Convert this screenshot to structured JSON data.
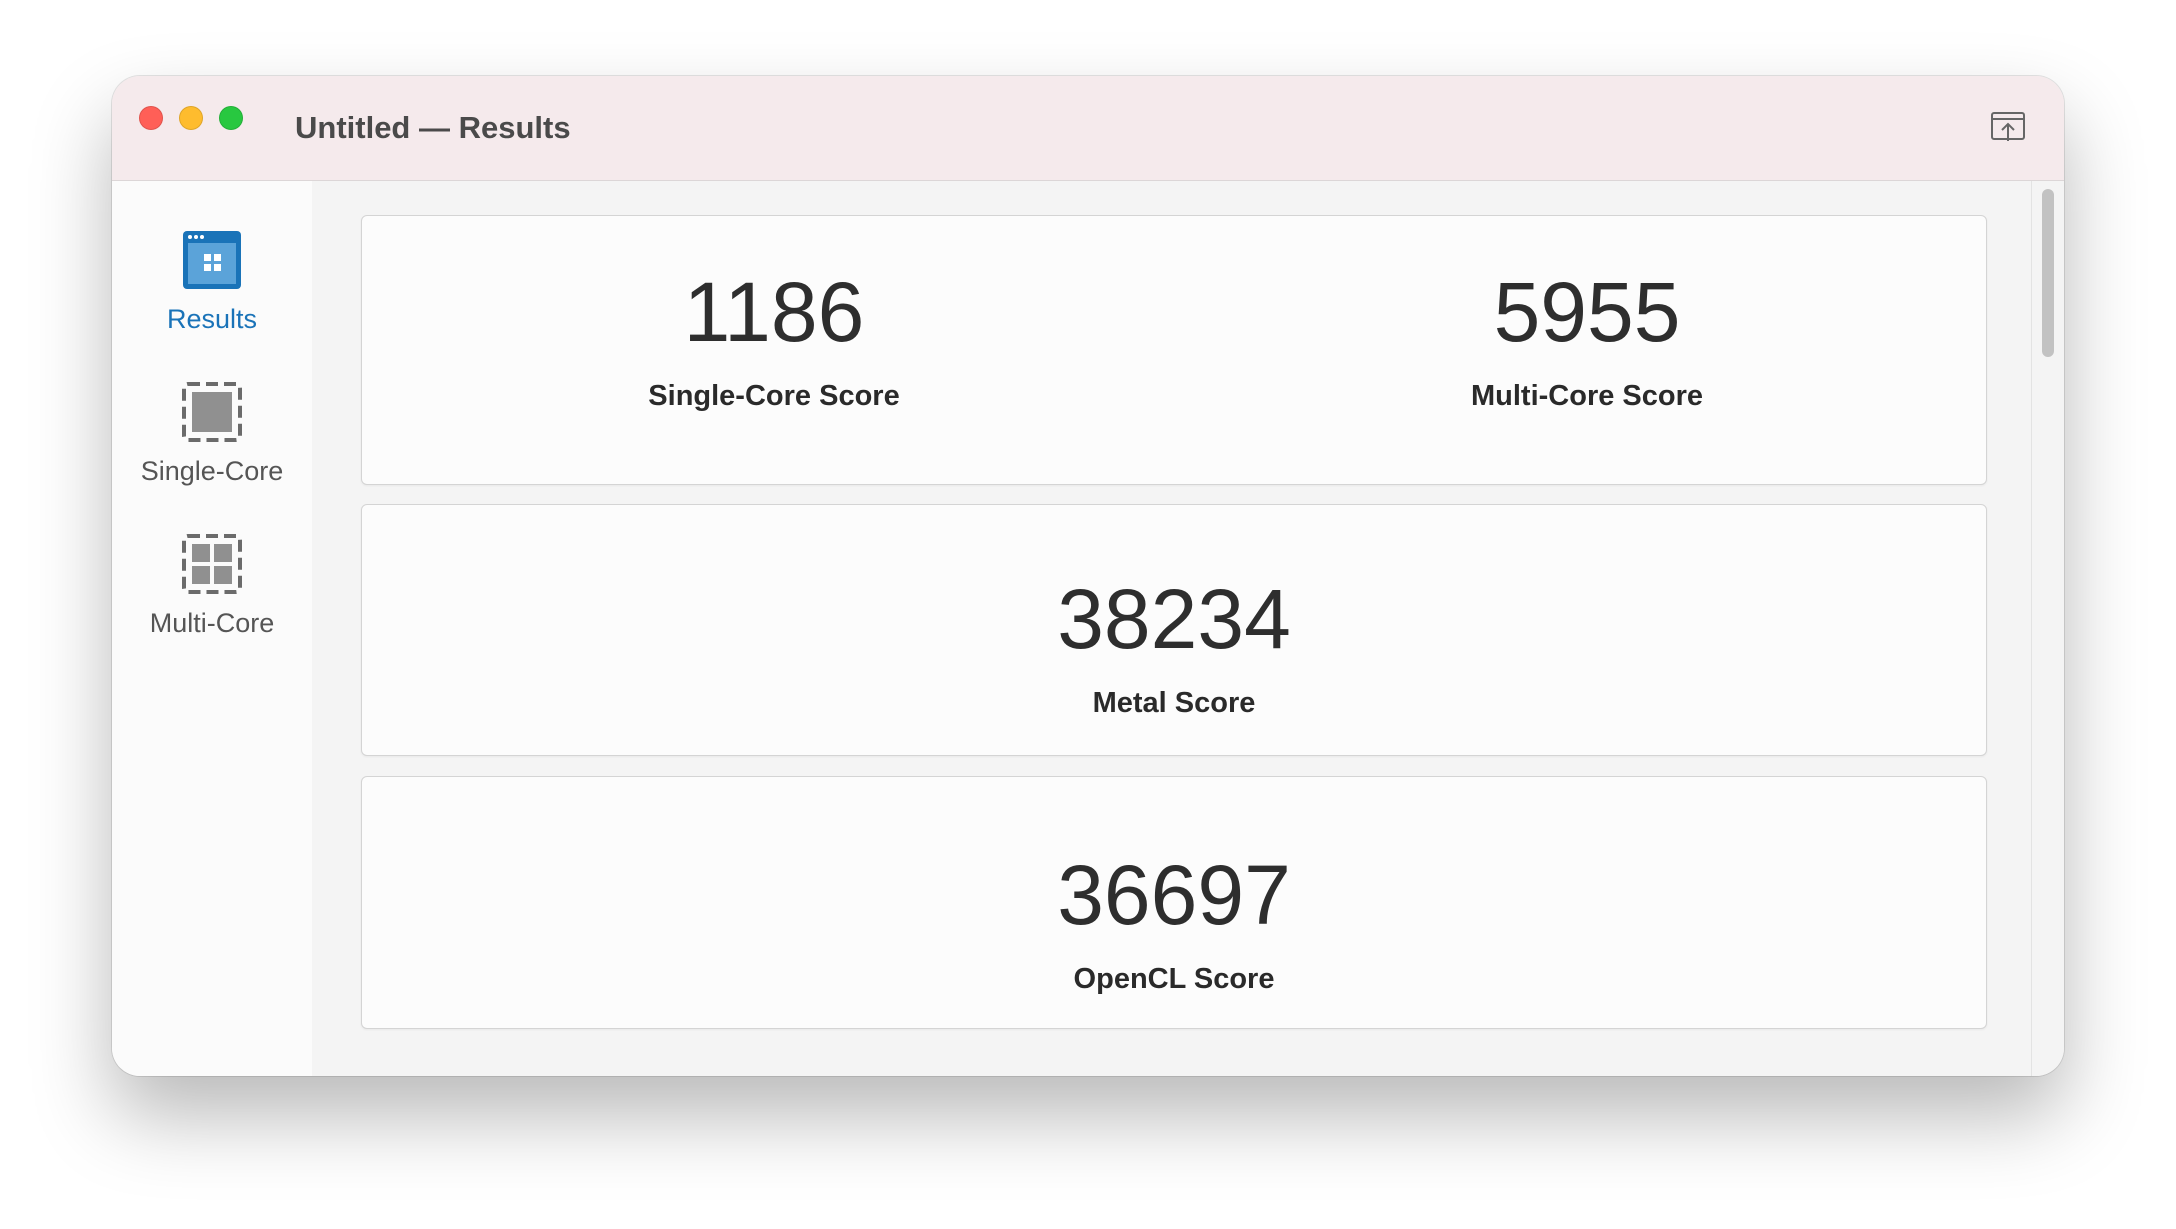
{
  "window": {
    "title": "Untitled — Results"
  },
  "toolbar": {
    "share_icon": "share-icon"
  },
  "sidebar": {
    "items": [
      {
        "label": "Results",
        "icon": "results-icon",
        "active": true
      },
      {
        "label": "Single-Core",
        "icon": "single-core-icon",
        "active": false
      },
      {
        "label": "Multi-Core",
        "icon": "multi-core-icon",
        "active": false
      }
    ]
  },
  "scores": {
    "single_core": {
      "value": "1186",
      "label": "Single-Core Score"
    },
    "multi_core": {
      "value": "5955",
      "label": "Multi-Core Score"
    },
    "metal": {
      "value": "38234",
      "label": "Metal Score"
    },
    "opencl": {
      "value": "36697",
      "label": "OpenCL Score"
    }
  },
  "colors": {
    "accent": "#1a73b8",
    "titlebar": "#f5eaec",
    "close": "#ff5f57",
    "minimize": "#febc2e",
    "maximize": "#28c840"
  }
}
